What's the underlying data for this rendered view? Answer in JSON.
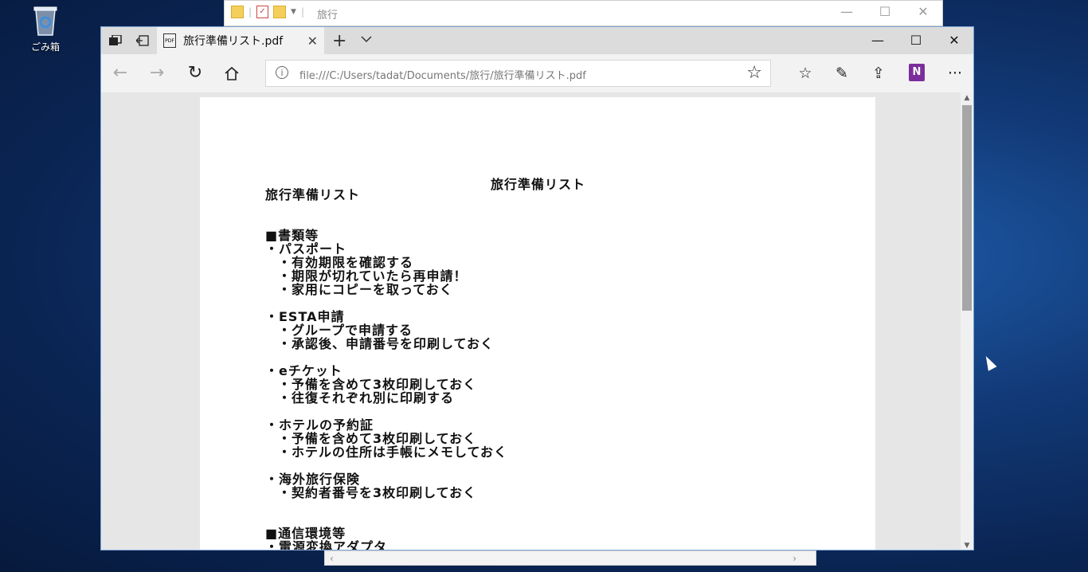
{
  "desktop": {
    "recycle_bin_label": "ごみ箱"
  },
  "explorer": {
    "title": "旅行",
    "controls": {
      "minimize": "—",
      "maximize": "☐",
      "close": "✕"
    }
  },
  "edge": {
    "tab": {
      "title": "旅行準備リスト.pdf"
    },
    "address": {
      "url": "file:///C:/Users/tadat/Documents/旅行/旅行準備リスト.pdf"
    },
    "controls": {
      "minimize": "—",
      "maximize": "☐",
      "close": "✕"
    }
  },
  "pdf": {
    "header": "旅行準備リスト",
    "lines": [
      {
        "text": "旅行準備リスト",
        "indent": 0,
        "gap_before": 0
      },
      {
        "text": "■書類等",
        "indent": 0,
        "gap_before": 2
      },
      {
        "text": "・パスポート",
        "indent": 0,
        "gap_before": 0
      },
      {
        "text": "・有効期限を確認する",
        "indent": 1,
        "gap_before": 0
      },
      {
        "text": "・期限が切れていたら再申請！",
        "indent": 1,
        "gap_before": 0
      },
      {
        "text": "・家用にコピーを取っておく",
        "indent": 1,
        "gap_before": 0
      },
      {
        "text": "・ESTA申請",
        "indent": 0,
        "gap_before": 1
      },
      {
        "text": "・グループで申請する",
        "indent": 1,
        "gap_before": 0
      },
      {
        "text": "・承認後、申請番号を印刷しておく",
        "indent": 1,
        "gap_before": 0
      },
      {
        "text": "・eチケット",
        "indent": 0,
        "gap_before": 1
      },
      {
        "text": "・予備を含めて3枚印刷しておく",
        "indent": 1,
        "gap_before": 0
      },
      {
        "text": "・往復それぞれ別に印刷する",
        "indent": 1,
        "gap_before": 0
      },
      {
        "text": "・ホテルの予約証",
        "indent": 0,
        "gap_before": 1
      },
      {
        "text": "・予備を含めて3枚印刷しておく",
        "indent": 1,
        "gap_before": 0
      },
      {
        "text": "・ホテルの住所は手帳にメモしておく",
        "indent": 1,
        "gap_before": 0
      },
      {
        "text": "・海外旅行保険",
        "indent": 0,
        "gap_before": 1
      },
      {
        "text": "・契約者番号を3枚印刷しておく",
        "indent": 1,
        "gap_before": 0
      },
      {
        "text": "■通信環境等",
        "indent": 0,
        "gap_before": 2
      },
      {
        "text": "・電源変換アダプタ",
        "indent": 0,
        "gap_before": 0
      }
    ]
  }
}
